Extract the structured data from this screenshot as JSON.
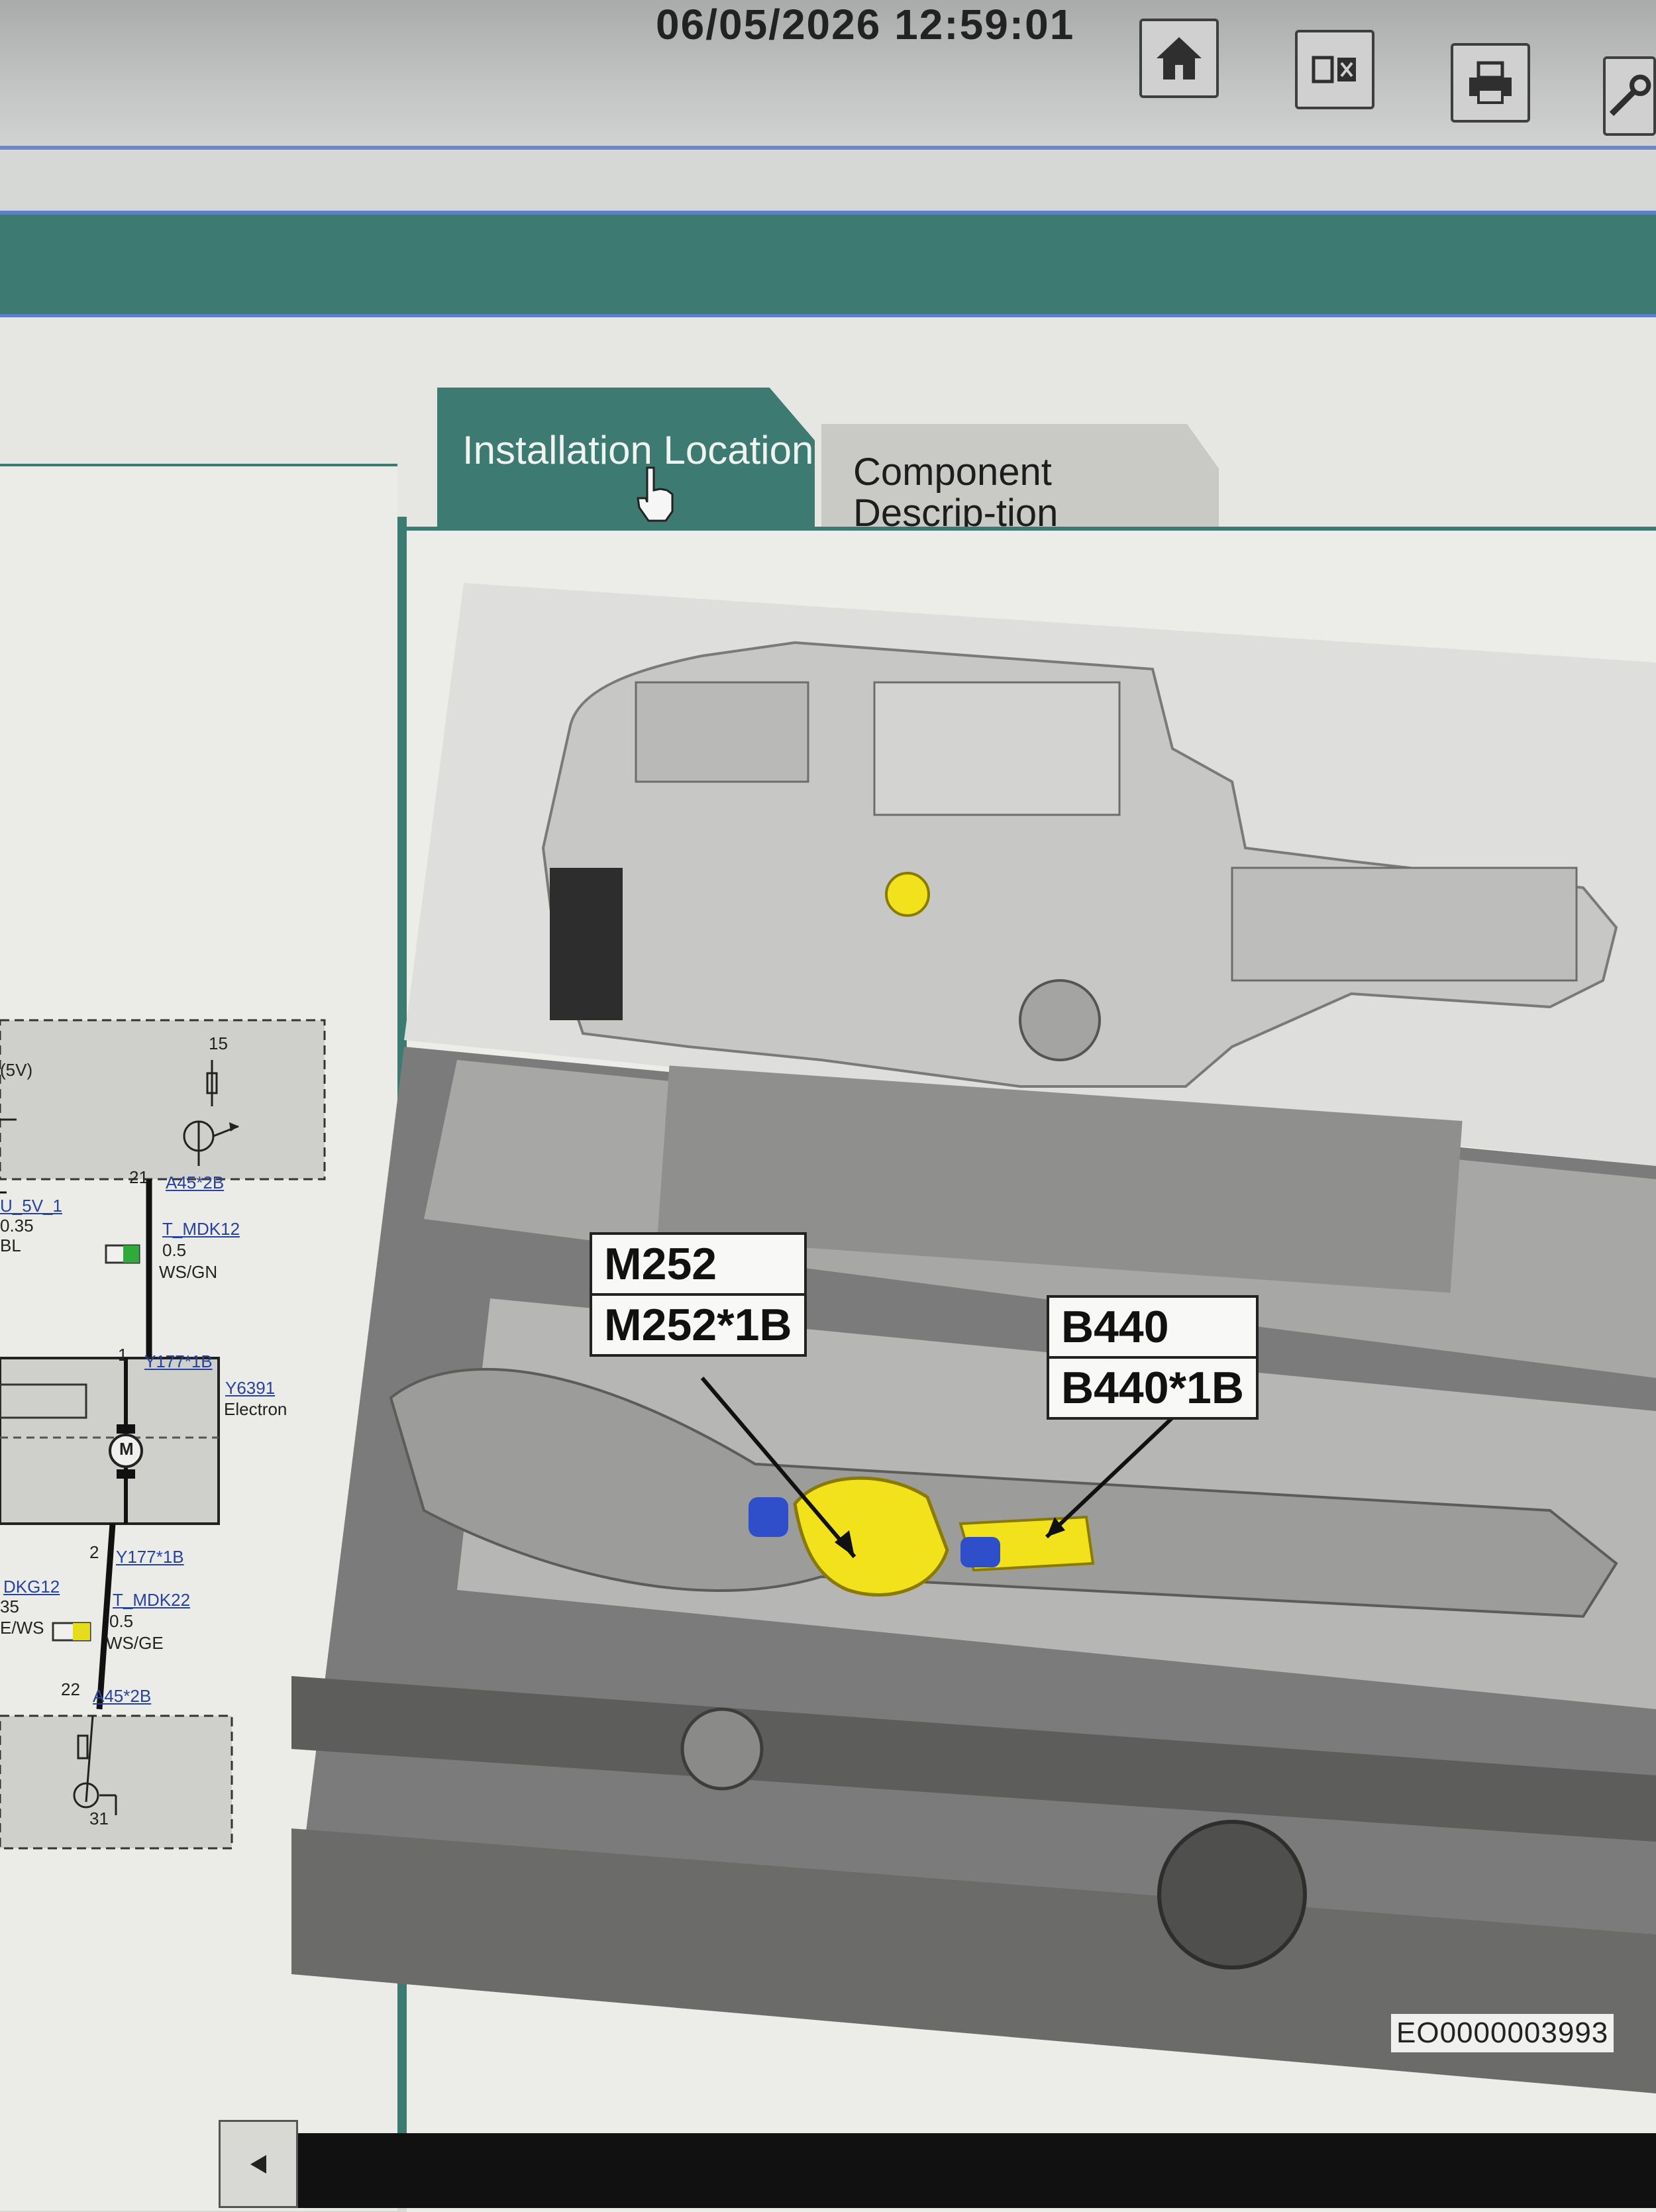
{
  "header": {
    "timestamp": "06/05/2026 12:59:01",
    "toolbar": [
      {
        "icon": "home-icon"
      },
      {
        "icon": "split-view-icon"
      },
      {
        "icon": "print-icon"
      },
      {
        "icon": "wrench-icon"
      }
    ]
  },
  "tabs": {
    "installation_location": "Installation Location",
    "component_description": "Component Descrip-tion"
  },
  "wiring": {
    "supply": "(5V)",
    "terminal_15": "15",
    "pin_21": "21",
    "conn_a45_2b_top": "A45*2B",
    "signal_u5v1": "U_5V_1",
    "size_035_top": "0.35",
    "color_bl": "BL",
    "signal_t_mdk12": "T_MDK12",
    "size_05_top": "0.5",
    "color_ws_gn": "WS/GN",
    "pin_1": "1",
    "conn_y177_1b_top": "Y177*1B",
    "component_y6391": "Y6391",
    "component_desc": "Electron",
    "motor_symbol": "M",
    "pin_2": "2",
    "conn_y177_1b_bottom": "Y177*1B",
    "signal_dkg12": "DKG12",
    "size_35": "35",
    "color_e_ws": "E/WS",
    "signal_t_mdk22": "T_MDK22",
    "size_05_bottom": "0.5",
    "color_ws_ge": "WS/GE",
    "pin_22": "22",
    "conn_a45_2b_bottom": "A45*2B",
    "terminal_31": "31"
  },
  "image": {
    "callouts": [
      {
        "code": "M252",
        "connector": "M252*1B"
      },
      {
        "code": "B440",
        "connector": "B440*1B"
      }
    ],
    "image_id": "EO0000003993",
    "highlight_color": "#f2e21c",
    "connector_color": "#2e4fc9"
  },
  "footer": {
    "scroll_icon": "triangle-left-icon"
  }
}
